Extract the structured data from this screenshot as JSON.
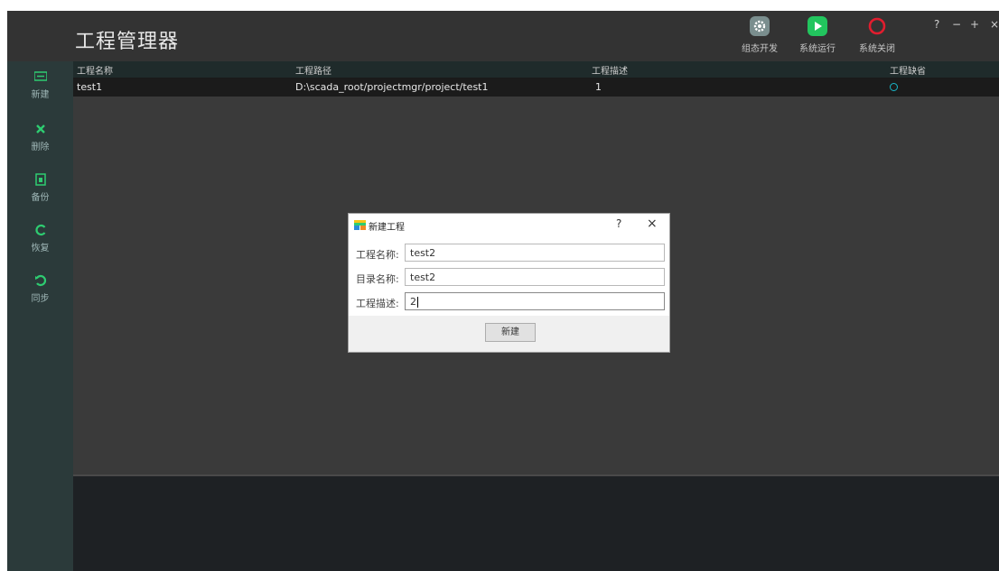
{
  "app": {
    "title": "工程管理器"
  },
  "toolbar": {
    "items": [
      {
        "label": "组态开发",
        "icon": "gear-icon",
        "color": "#7a8e8e"
      },
      {
        "label": "系统运行",
        "icon": "play-icon",
        "color": "#22c55e"
      },
      {
        "label": "系统关闭",
        "icon": "power-icon",
        "color": "#e11d2e"
      }
    ]
  },
  "window_controls": {
    "help": "?",
    "minimize": "−",
    "maximize": "+",
    "close": "×"
  },
  "sidebar": {
    "items": [
      {
        "label": "新建",
        "icon": "new-project-icon"
      },
      {
        "label": "删除",
        "icon": "delete-x-icon"
      },
      {
        "label": "备份",
        "icon": "backup-icon"
      },
      {
        "label": "恢复",
        "icon": "restore-icon"
      },
      {
        "label": "同步",
        "icon": "sync-icon"
      }
    ],
    "accent": "#2ecc71"
  },
  "table": {
    "columns": [
      "工程名称",
      "工程路径",
      "工程描述",
      "工程缺省"
    ],
    "rows": [
      {
        "name": "test1",
        "path": "D:\\scada_root/projectmgr/project/test1",
        "description": "1",
        "default": "status-ring"
      }
    ]
  },
  "dialog": {
    "title": "新建工程",
    "help": "?",
    "close": "×",
    "fields": [
      {
        "label": "工程名称:",
        "value": "test2"
      },
      {
        "label": "目录名称:",
        "value": "test2"
      },
      {
        "label": "工程描述:",
        "value": "2"
      }
    ],
    "button": "新建"
  }
}
